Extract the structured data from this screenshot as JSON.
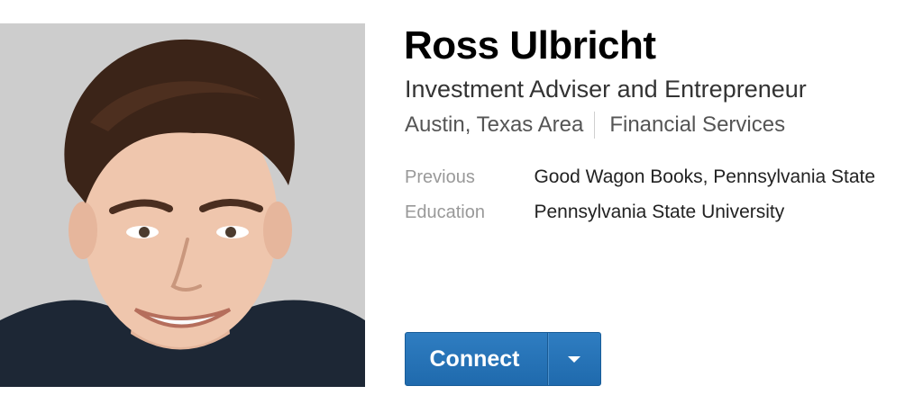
{
  "profile": {
    "name": "Ross Ulbricht",
    "headline": "Investment Adviser and Entrepreneur",
    "location": "Austin, Texas Area",
    "industry": "Financial Services",
    "previous_label": "Previous",
    "previous_value": "Good Wagon Books, Pennsylvania State",
    "education_label": "Education",
    "education_value": "Pennsylvania State University"
  },
  "actions": {
    "connect_label": "Connect",
    "dropdown_icon": "caret-down-icon",
    "accent_color": "#2f7dc1"
  },
  "photo": {
    "icon": "profile-photo"
  }
}
